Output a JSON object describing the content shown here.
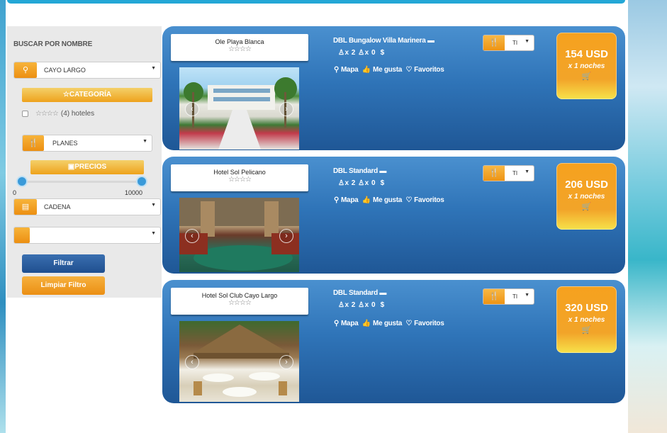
{
  "sidebar": {
    "title": "BUSCAR POR NOMBRE",
    "destination": "CAYO LARGO",
    "category_label": "CATEGORÍA",
    "category_stars": "☆☆☆☆",
    "category_count": "(4) hoteles",
    "plans_label": "PLANES",
    "prices_label": "PRECIOS",
    "price_min": "0",
    "price_max": "10000",
    "chain_label": "CADENA",
    "last_select": "",
    "filter_button": "Filtrar",
    "clear_button": "Limpiar Filtro"
  },
  "hotels": [
    {
      "name": "Ole Playa Blanca",
      "stars": "☆☆☆☆",
      "room": "DBL Bungalow Villa Marinera",
      "adults": "x 2",
      "children": "x 0",
      "currency_symbol": "$",
      "map": "Mapa",
      "like": "Me gusta",
      "fav": "Favoritos",
      "plan": "TI",
      "price": "154 USD",
      "nights": "x 1 noches"
    },
    {
      "name": "Hotel Sol Pelicano",
      "stars": "☆☆☆☆",
      "room": "DBL Standard",
      "adults": "x 2",
      "children": "x 0",
      "currency_symbol": "$",
      "map": "Mapa",
      "like": "Me gusta",
      "fav": "Favoritos",
      "plan": "TI",
      "price": "206 USD",
      "nights": "x 1 noches"
    },
    {
      "name": "Hotel Sol Club Cayo Largo",
      "stars": "☆☆☆☆",
      "room": "DBL Standard",
      "adults": "x 2",
      "children": "x 0",
      "currency_symbol": "$",
      "map": "Mapa",
      "like": "Me gusta",
      "fav": "Favoritos",
      "plan": "TI",
      "price": "320 USD",
      "nights": "x 1 noches"
    }
  ],
  "colors": {
    "accent_orange": "#ee9414",
    "card_blue": "#2f74b8",
    "top_strip": "#23a7d6"
  },
  "icons": {
    "location": "map-marker-icon",
    "star": "star-icon",
    "plans": "restaurant-icon",
    "money": "money-icon",
    "chain": "building-icon",
    "bed": "bed-icon",
    "adult": "person-icon",
    "child": "child-icon",
    "cart": "cart-icon",
    "like": "thumbs-up-icon",
    "fav": "heart-icon"
  }
}
